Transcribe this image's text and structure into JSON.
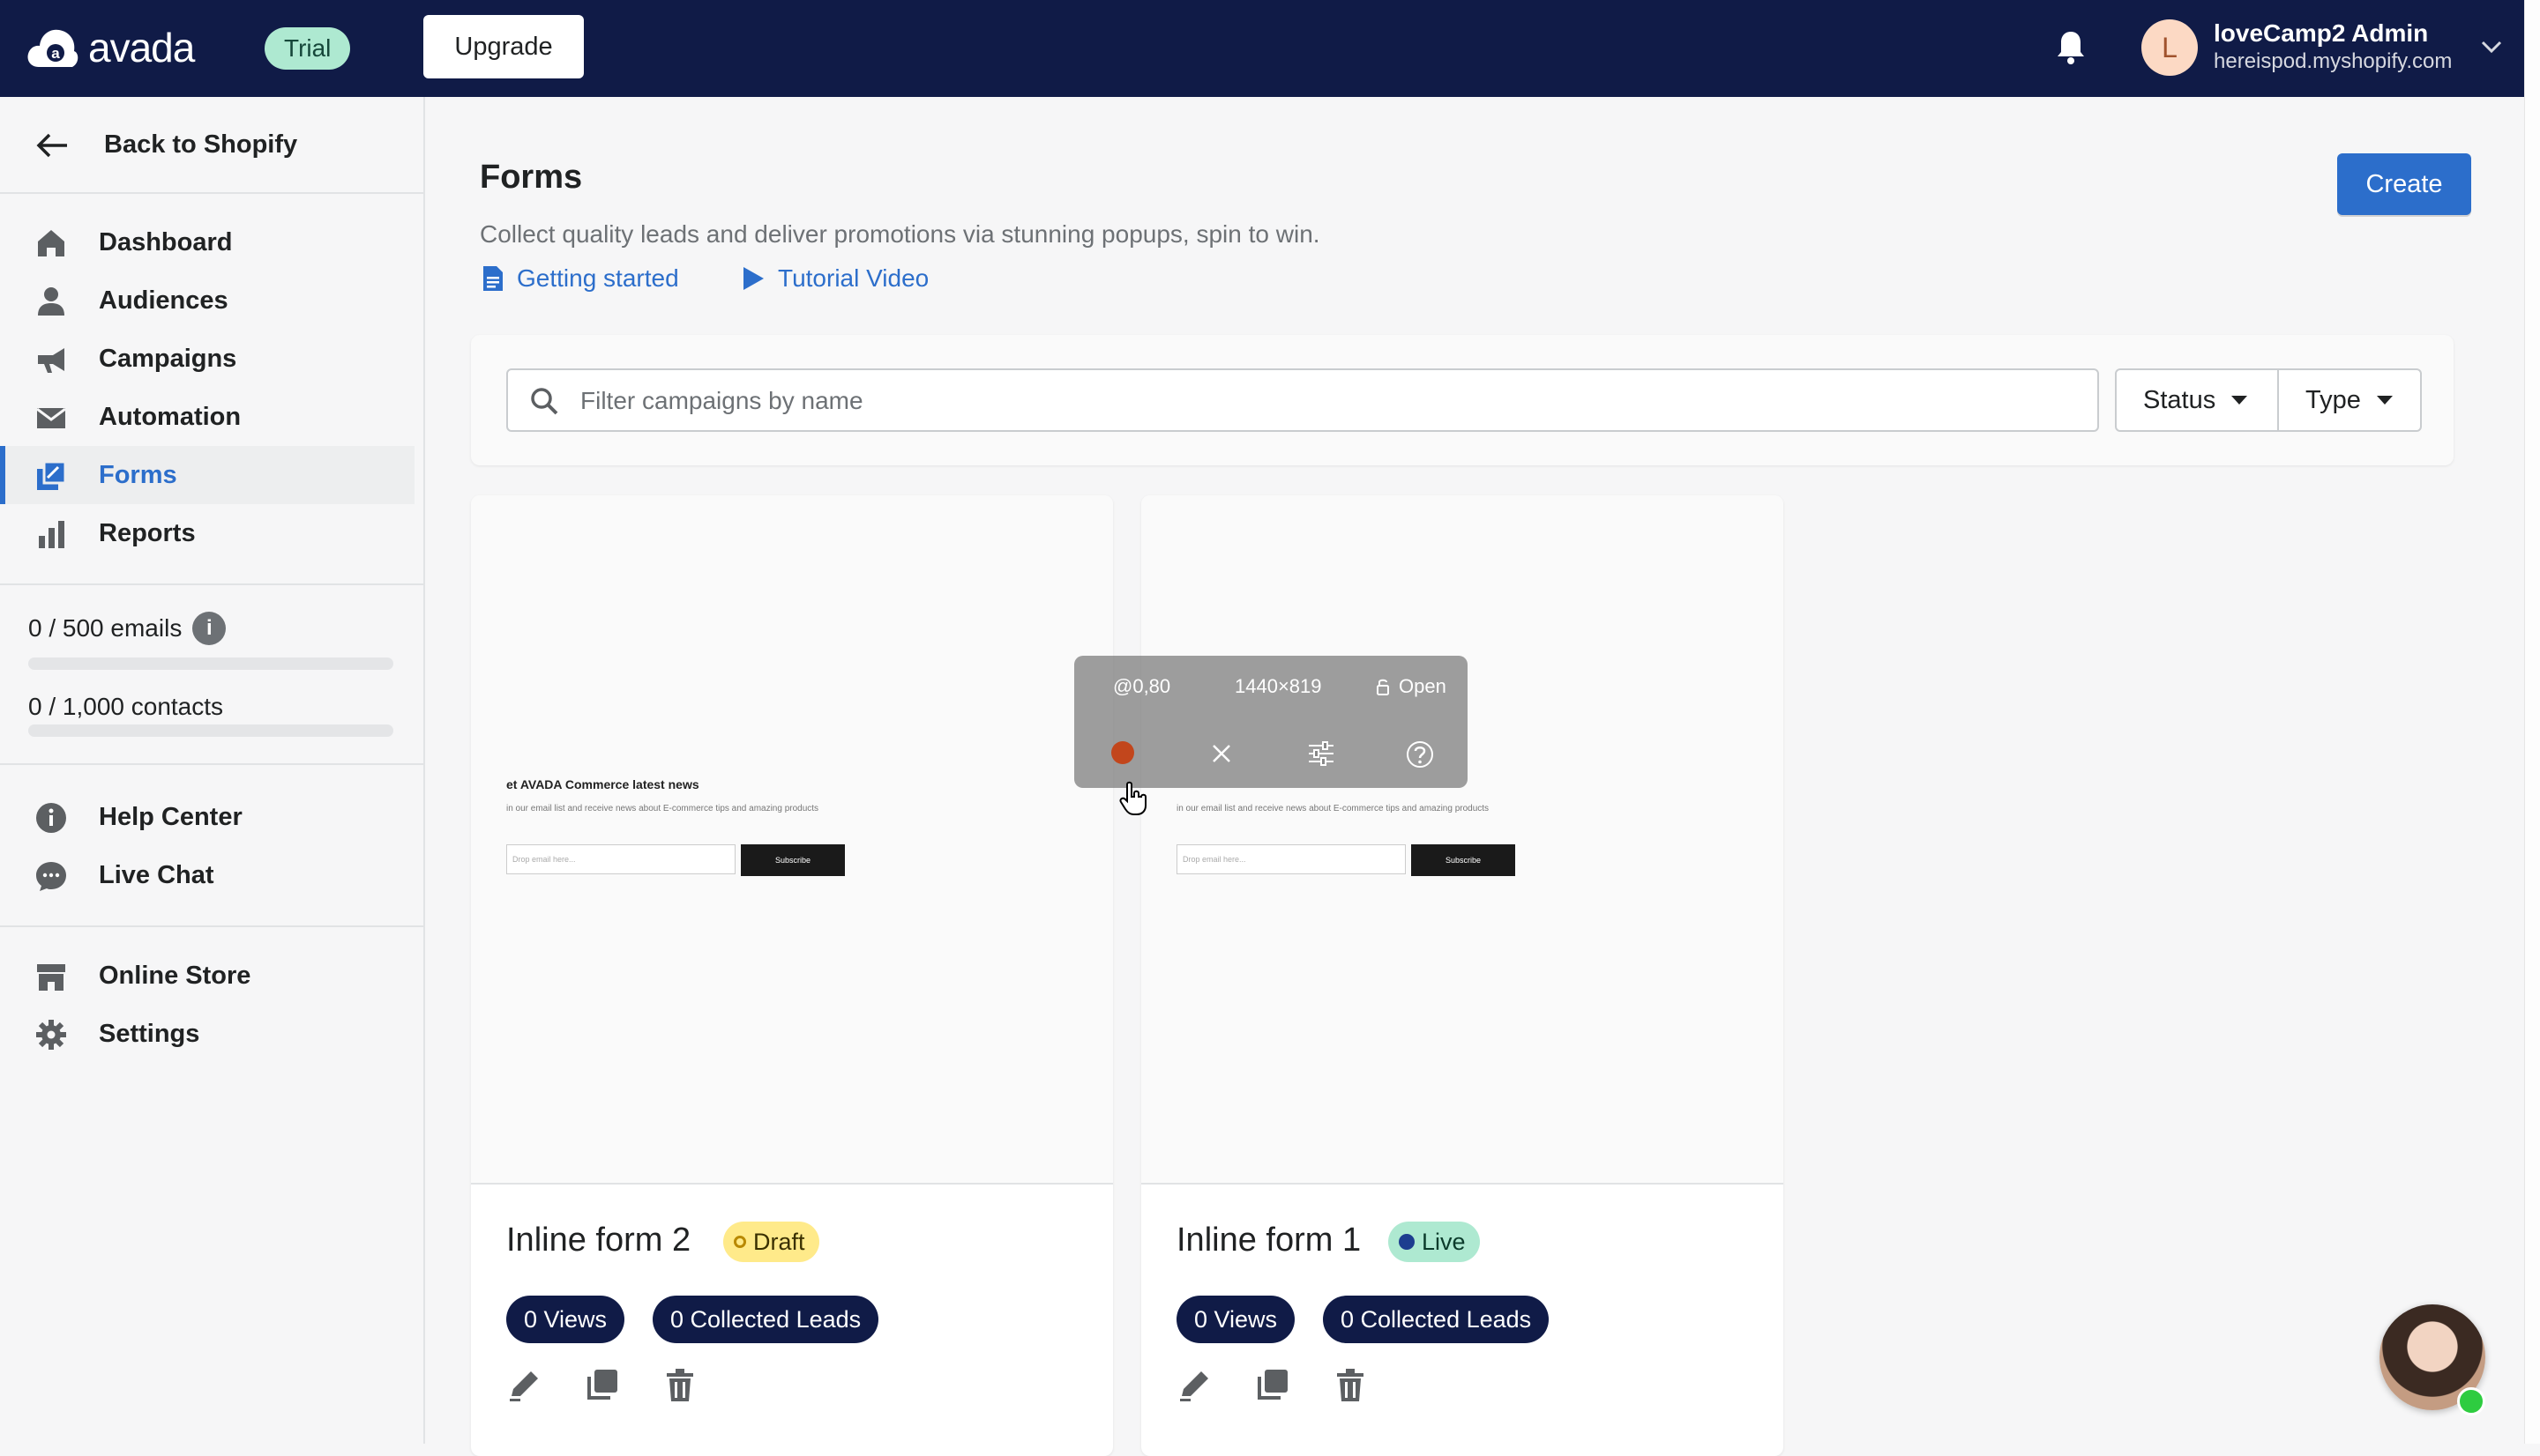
{
  "header": {
    "logo_text": "avada",
    "trial_label": "Trial",
    "upgrade_label": "Upgrade",
    "user": {
      "initial": "L",
      "name": "loveCamp2 Admin",
      "shop": "hereispod.myshopify.com"
    }
  },
  "sidebar": {
    "back_label": "Back to Shopify",
    "nav": [
      {
        "label": "Dashboard",
        "icon": "home-icon"
      },
      {
        "label": "Audiences",
        "icon": "person-icon"
      },
      {
        "label": "Campaigns",
        "icon": "megaphone-icon"
      },
      {
        "label": "Automation",
        "icon": "envelope-icon"
      },
      {
        "label": "Forms",
        "icon": "forms-icon",
        "active": true
      },
      {
        "label": "Reports",
        "icon": "bar-chart-icon"
      }
    ],
    "usage": [
      {
        "label": "0 / 500 emails",
        "fraction": 0
      },
      {
        "label": "0 / 1,000 contacts",
        "fraction": 0
      }
    ],
    "help": [
      {
        "label": "Help Center",
        "icon": "info-icon"
      },
      {
        "label": "Live Chat",
        "icon": "chat-icon"
      }
    ],
    "store": [
      {
        "label": "Online Store",
        "icon": "store-icon"
      },
      {
        "label": "Settings",
        "icon": "gear-icon"
      }
    ]
  },
  "main": {
    "title": "Forms",
    "subtitle": "Collect quality leads and deliver promotions via stunning popups, spin to win.",
    "links": {
      "getting_started": "Getting started",
      "tutorial_video": "Tutorial Video"
    },
    "create_label": "Create",
    "filter": {
      "placeholder": "Filter campaigns by name",
      "value": "",
      "status_label": "Status",
      "type_label": "Type"
    },
    "cards": [
      {
        "title": "Inline form 2",
        "status": "Draft",
        "views": "0 Views",
        "leads": "0 Collected Leads",
        "preview": {
          "heading": "et AVADA Commerce latest news",
          "desc": "in our email list and receive news about E-commerce tips and amazing products",
          "input_placeholder": "Drop email here...",
          "button": "Subscribe"
        }
      },
      {
        "title": "Inline form 1",
        "status": "Live",
        "views": "0 Views",
        "leads": "0 Collected Leads",
        "preview": {
          "heading": "",
          "desc": "in our email list and receive news about E-commerce tips and amazing products",
          "input_placeholder": "Drop email here...",
          "button": "Subscribe"
        }
      }
    ]
  },
  "recorder_overlay": {
    "position_readout": "@0,80",
    "size_readout": "1440×819",
    "lock_label": "Open"
  },
  "colors": {
    "header_bg": "#101b47",
    "accent": "#2c6ecb",
    "draft_badge": "#ffea8a",
    "live_badge": "#aee9d1"
  }
}
